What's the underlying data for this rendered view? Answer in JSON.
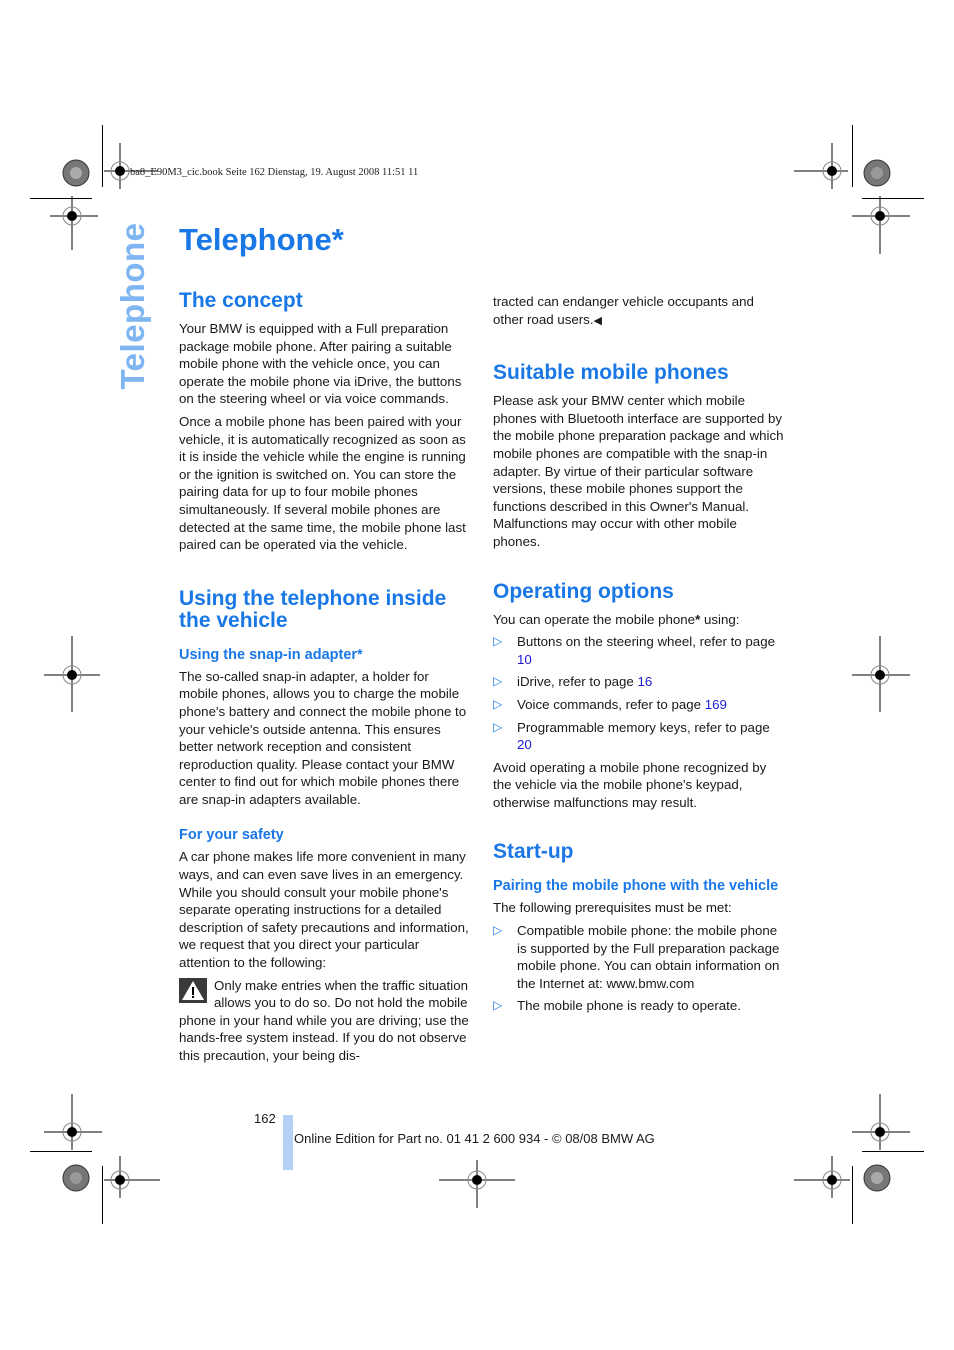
{
  "print_info": "ba8_E90M3_cic.book  Seite 162  Dienstag, 19. August 2008  11:51 11",
  "side_tab": "Telephone",
  "page_title": "Telephone*",
  "left_column": {
    "concept": {
      "heading": "The concept",
      "paragraphs": [
        "Your BMW is equipped with a Full preparation package mobile phone. After pairing a suitable mobile phone with the vehicle once, you can operate the mobile phone via iDrive, the buttons on the steering wheel or via voice commands.",
        "Once a mobile phone has been paired with your vehicle, it is automatically recognized as soon as it is inside the vehicle while the engine is running or the ignition is switched on. You can store the pairing data for up to four mobile phones simultaneously. If several mobile phones are detected at the same time, the mobile phone last paired can be operated via the vehicle."
      ]
    },
    "using": {
      "heading": "Using the telephone inside the vehicle",
      "snapin_heading": "Using the snap-in adapter*",
      "snapin_text": "The so-called snap-in adapter, a holder for mobile phones, allows you to charge the mobile phone's battery and connect the mobile phone to your vehicle's outside antenna. This ensures better network reception and consistent reproduction quality. Please contact your BMW center to find out for which mobile phones there are snap-in adapters available.",
      "safety_heading": "For your safety",
      "safety_text": "A car phone makes life more convenient in many ways, and can even save lives in an emergency. While you should consult your mobile phone's separate operating instructions for a detailed description of safety precautions and information, we request that you direct your particular attention to the following:",
      "warning_text": "Only make entries when the traffic situation allows you to do so. Do not hold the mobile phone in your hand while you are driving; use the hands-free system instead. If you do not observe this precaution, your being dis-"
    }
  },
  "right_column": {
    "warning_continued": "tracted can endanger vehicle occupants and other road users.",
    "end_mark": "◀",
    "suitable": {
      "heading": "Suitable mobile phones",
      "text": "Please ask your BMW center which mobile phones with Bluetooth interface are supported by the mobile phone preparation package and which mobile phones are compatible with the snap-in adapter. By virtue of their particular software versions, these mobile phones support the functions described in this Owner's Manual. Malfunctions may occur with other mobile phones."
    },
    "operating": {
      "heading": "Operating options",
      "intro": "You can operate the mobile phone",
      "intro_star": "*",
      "intro_end": " using:",
      "items": [
        {
          "text": "Buttons on the steering wheel, refer to page ",
          "page": "10"
        },
        {
          "text": "iDrive, refer to page ",
          "page": "16"
        },
        {
          "text": "Voice commands, refer to page ",
          "page": "169"
        },
        {
          "text": "Programmable memory keys, refer to page ",
          "page": "20"
        }
      ],
      "note": "Avoid operating a mobile phone recognized by the vehicle via the mobile phone's keypad, otherwise malfunctions may result."
    },
    "startup": {
      "heading": "Start-up",
      "sub_heading": "Pairing the mobile phone with the vehicle",
      "intro": "The following prerequisites must be met:",
      "items": [
        "Compatible mobile phone: the mobile phone is supported by the Full preparation package mobile phone. You can obtain information on the Internet at: www.bmw.com",
        "The mobile phone is ready to operate."
      ]
    }
  },
  "footer": {
    "page_number": "162",
    "edition": "Online Edition for Part no. 01 41 2 600 934 - © 08/08 BMW AG"
  },
  "colors": {
    "heading_blue": "#1a78e6",
    "side_tab_blue": "#7fb6f2",
    "link_blue": "#1a1ad6",
    "footer_bar": "#b3d1f5"
  }
}
